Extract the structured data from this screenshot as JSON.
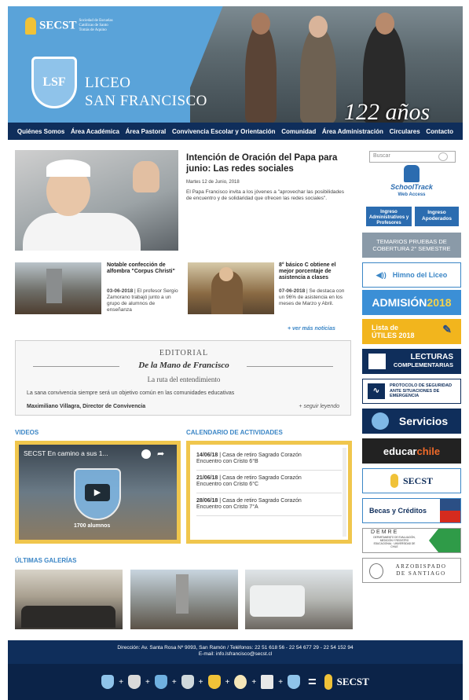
{
  "header": {
    "org_name": "SECST",
    "org_tagline": "Sociedad de Escuelas Católicas de Santo Tomás de Aquino",
    "school_line1": "LICEO",
    "school_line2": "SAN FRANCISCO",
    "shield_text": "LSF",
    "anniversary": "122 años"
  },
  "nav": [
    "Quiénes Somos",
    "Área Académica",
    "Área Pastoral",
    "Convivencia Escolar y Orientación",
    "Comunidad",
    "Área Administración",
    "Circulares",
    "Contacto"
  ],
  "main_news": {
    "title": "Intención de Oración del Papa para junio: Las redes sociales",
    "date": "Martes 12 de Junio, 2018",
    "text": "El Papa Francisco invita a los jóvenes a \"aprovechar las posibilidades de encuentro y de solidaridad que ofrecen las redes sociales\"."
  },
  "small_news": [
    {
      "title": "Notable confección de alfombra \"Corpus Christi\"",
      "date": "03-06-2018",
      "text": " | El profesor Sergio Zamorano trabajó junto a un grupo de alumnos de enseñanza"
    },
    {
      "title": "8° básico C obtiene el mejor porcentaje de asistencia a clases",
      "date": "07-06-2018",
      "text": " | Se destaca con un 96% de asistencia en los meses de Marzo y Abril."
    }
  ],
  "more_news": "+ ver más noticias",
  "editorial": {
    "label": "EDITORIAL",
    "title": "De la Mano de Francisco",
    "subtitle": "La ruta del entendimiento",
    "text": "La sana convivencia siempre será un objetivo común en las comunidades educativas",
    "author": "Maximiliano Villagra, Director de Convivencia",
    "more": "+ seguir leyendo"
  },
  "videos": {
    "section_title": "VIDEOS",
    "video_title": "SECST En camino a sus 1...",
    "count_label": "1700 alumnos"
  },
  "calendar": {
    "section_title": "CALENDARIO DE ACTIVIDADES",
    "items": [
      {
        "date": "14/06/18",
        "title": " | Casa de retiro Sagrado Corazón",
        "detail": "Encuentro con Cristo 6°B"
      },
      {
        "date": "21/06/18",
        "title": " | Casa de retiro Sagrado Corazón",
        "detail": "Encuentro con Cristo 6°C"
      },
      {
        "date": "28/06/18",
        "title": " | Casa de retiro Sagrado Corazón",
        "detail": "Encuentro con Cristo 7°A"
      }
    ]
  },
  "galleries": {
    "section_title": "ÚLTIMAS GALERÍAS"
  },
  "sidebar": {
    "search_placeholder": "Buscar",
    "schooltrack_title": "SchoolTrack",
    "schooltrack_sub": "Web Access",
    "login_staff": "Ingreso Administrativos y Profesores",
    "login_parents": "Ingreso Apoderados",
    "temarios": "TEMARIOS PRUEBAS DE COBERTURA 2° SEMESTRE",
    "himno": "Himno del Liceo",
    "admision_a": "ADMISIÓN",
    "admision_b": "2018",
    "utiles_a": "Lista de",
    "utiles_b": "ÚTILES 2018",
    "lecturas_a": "LECTURAS",
    "lecturas_b": "COMPLEMENTARIAS",
    "protocolo": "PROTOCOLO DE SEGURIDAD ANTE SITUACIONES DE EMERGENCIA",
    "servicios": "Servicios",
    "educarchile_a": "educar",
    "educarchile_b": "chile",
    "secst_banner": "SECST",
    "becas": "Becas y Créditos",
    "demre": "DEMRE",
    "demre_sub": "DEPARTAMENTO DE EVALUACIÓN, MEDICIÓN Y REGISTRO EDUCACIONAL · UNIVERSIDAD DE CHILE",
    "arzobispado_a": "Arzobispado",
    "arzobispado_b": "de Santiago"
  },
  "footer": {
    "address": "Dirección: Av. Santa Rosa Nº 9093, San Ramón / Teléfonos: 22 51 618 56 - 22 54 677 29 - 22 54 152 94",
    "email": "E-mail: info.lsfrancisco@secst.cl",
    "org": "SECST"
  },
  "colors": {
    "navy": "#0f2e5b",
    "header_blue": "#5aa3d9",
    "accent_blue": "#3b86c6",
    "gold": "#f0c64d"
  }
}
